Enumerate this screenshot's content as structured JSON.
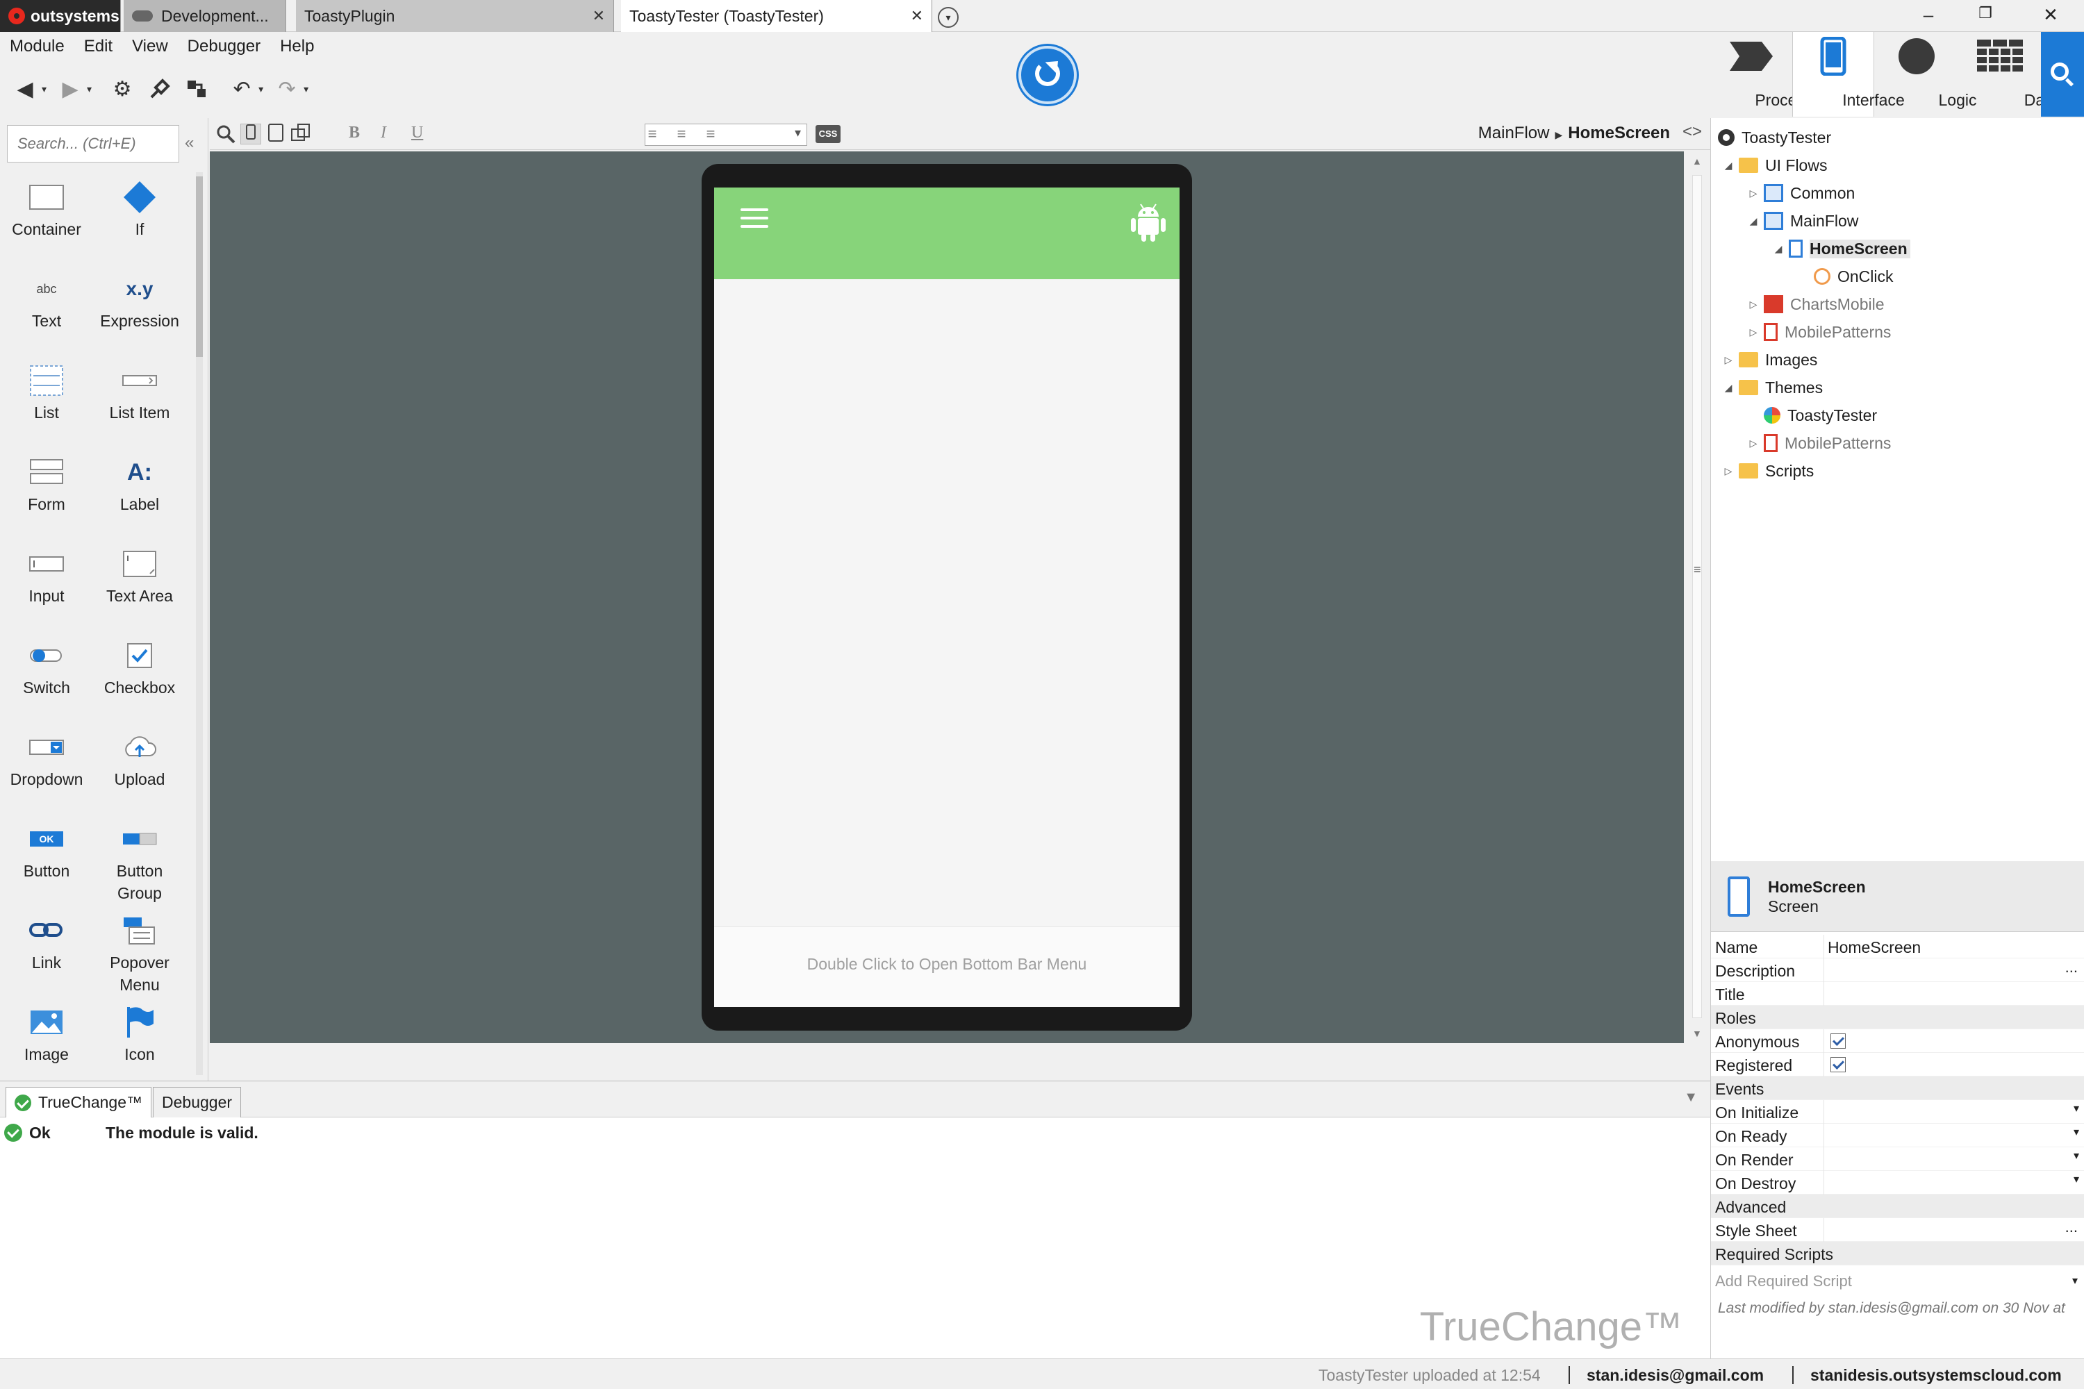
{
  "tabs": {
    "os": "outsystems",
    "dev": "Development...",
    "plugin": "ToastyPlugin",
    "tester": "ToastyTester (ToastyTester)",
    "more": "▾"
  },
  "window": {
    "minimize": "–",
    "restore": "❐",
    "close": "✕"
  },
  "menu": [
    "Module",
    "Edit",
    "View",
    "Debugger",
    "Help"
  ],
  "toolbar": {
    "back": "◀",
    "forward": "▶",
    "settings": "⚙",
    "undo": "↶",
    "redo": "↷",
    "caret": "▾"
  },
  "nav": {
    "processes": "Processes",
    "interface": "Interface",
    "logic": "Logic",
    "data": "Data"
  },
  "toolbox": {
    "search_placeholder": "Search... (Ctrl+E)",
    "collapse": "«",
    "items": [
      {
        "label": "Container"
      },
      {
        "label": "If"
      },
      {
        "label": "Text"
      },
      {
        "label": "Expression"
      },
      {
        "label": "List"
      },
      {
        "label": "List Item"
      },
      {
        "label": "Form"
      },
      {
        "label": "Label"
      },
      {
        "label": "Input"
      },
      {
        "label": "Text Area"
      },
      {
        "label": "Switch"
      },
      {
        "label": "Checkbox"
      },
      {
        "label": "Dropdown"
      },
      {
        "label": "Upload"
      },
      {
        "label": "Button"
      },
      {
        "label": "Button Group"
      },
      {
        "label": "Link"
      },
      {
        "label": "Popover Menu"
      },
      {
        "label": "Image"
      },
      {
        "label": "Icon"
      }
    ],
    "icon_text": {
      "text": "abc",
      "expression": "x.y",
      "label": "A:",
      "button": "OK"
    }
  },
  "canvas_toolbar": {
    "bold": "B",
    "italic": "I",
    "underline": "U",
    "css": "CSS",
    "breadcrumb_parent": "MainFlow",
    "breadcrumb_current": "HomeScreen",
    "code_toggle": "<>"
  },
  "canvas": {
    "bottom_bar_text": "Double Click to Open Bottom Bar Menu",
    "header_color": "#87d47a",
    "background_color": "#596566"
  },
  "bottom_panel": {
    "tab_truechange": "TrueChange™",
    "tab_debugger": "Debugger",
    "message_status": "Ok",
    "message_text": "The module is valid.",
    "watermark": "TrueChange™"
  },
  "tree": {
    "root": "ToastyTester",
    "ui_flows": "UI Flows",
    "common": "Common",
    "mainflow": "MainFlow",
    "homescreen": "HomeScreen",
    "onclick": "OnClick",
    "charts": "ChartsMobile",
    "patterns1": "MobilePatterns",
    "images": "Images",
    "themes": "Themes",
    "theme_tester": "ToastyTester",
    "patterns2": "MobilePatterns",
    "scripts": "Scripts"
  },
  "properties": {
    "title": "HomeScreen",
    "subtitle": "Screen",
    "name_key": "Name",
    "name_val": "HomeScreen",
    "description": "Description",
    "title_key": "Title",
    "roles": "Roles",
    "anonymous": "Anonymous",
    "registered": "Registered",
    "events": "Events",
    "on_initialize": "On Initialize",
    "on_ready": "On Ready",
    "on_render": "On Render",
    "on_destroy": "On Destroy",
    "advanced": "Advanced",
    "style_sheet": "Style Sheet",
    "required_scripts": "Required Scripts",
    "add_script": "Add Required Script",
    "last_modified": "Last modified by stan.idesis@gmail.com on 30 Nov at",
    "dots": "...",
    "dd": "▾"
  },
  "status": {
    "upload": "ToastyTester uploaded at 12:54",
    "user": "stan.idesis@gmail.com",
    "server": "stanidesis.outsystemscloud.com"
  },
  "colors": {
    "accent": "#1c7ad6",
    "ok_green": "#3fa84a"
  }
}
